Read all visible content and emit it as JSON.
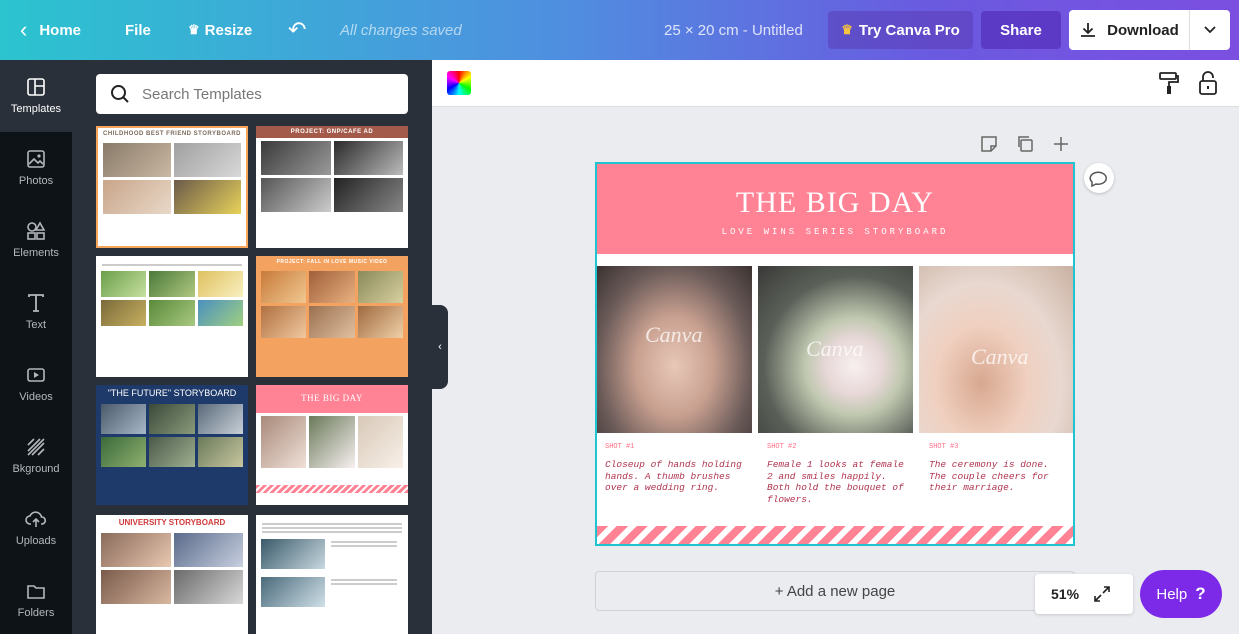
{
  "topbar": {
    "home": "Home",
    "file": "File",
    "resize": "Resize",
    "saved_status": "All changes saved",
    "doc_title": "25 × 20 cm - Untitled",
    "try_pro": "Try Canva Pro",
    "share": "Share",
    "download": "Download"
  },
  "rail": {
    "items": [
      {
        "label": "Templates",
        "icon": "templates-icon"
      },
      {
        "label": "Photos",
        "icon": "photos-icon"
      },
      {
        "label": "Elements",
        "icon": "elements-icon"
      },
      {
        "label": "Text",
        "icon": "text-icon"
      },
      {
        "label": "Videos",
        "icon": "videos-icon"
      },
      {
        "label": "Bkground",
        "icon": "background-icon"
      },
      {
        "label": "Uploads",
        "icon": "uploads-icon"
      },
      {
        "label": "Folders",
        "icon": "folders-icon"
      }
    ]
  },
  "search": {
    "placeholder": "Search Templates"
  },
  "templates": {
    "t1": "CHILDHOOD BEST FRIEND STORYBOARD",
    "t2": "PROJECT: GNP/CAFE AD",
    "t4": "PROJECT: FALL IN LOVE MUSIC VIDEO",
    "t5": "\"THE FUTURE\" STORYBOARD",
    "t6": "THE BIG DAY",
    "t7": "UNIVERSITY STORYBOARD"
  },
  "design": {
    "title": "THE BIG DAY",
    "subtitle": "LOVE WINS SERIES STORYBOARD",
    "watermark": "Canva",
    "shots": [
      {
        "label": "SHOT #1",
        "text": "Closeup of hands holding hands. A thumb brushes over a wedding ring."
      },
      {
        "label": "SHOT #2",
        "text": "Female 1 looks at female 2 and smiles happily. Both hold the bouquet of flowers."
      },
      {
        "label": "SHOT #3",
        "text": "The ceremony is done. The couple cheers for their marriage."
      }
    ],
    "colors": {
      "header": "#ff8295",
      "border": "#1fc4d0",
      "text": "#b0344f"
    }
  },
  "add_page": "+ Add a new page",
  "zoom": "51%",
  "help": "Help",
  "help_mark": "?"
}
